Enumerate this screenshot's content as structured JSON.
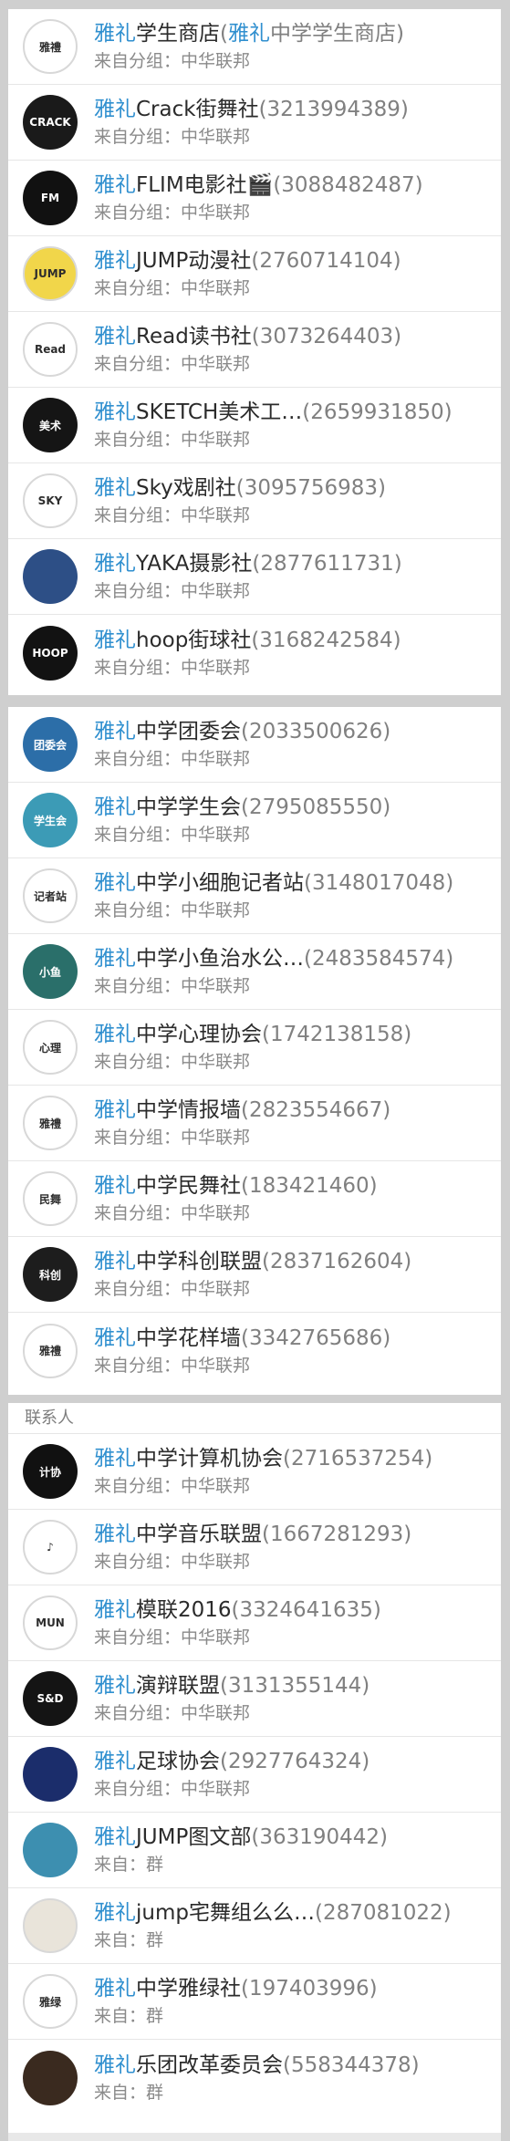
{
  "groups": [
    {
      "items": [
        {
          "prefix": "雅礼",
          "name": "学生商店",
          "tail": "(",
          "tail_prefix": "雅礼",
          "tail_rest": "中学学生商店)",
          "source": "来自分组：中华联邦",
          "avatar_text": "雅禮",
          "avatar_color": "#ffffff"
        },
        {
          "prefix": "雅礼",
          "name": "Crack街舞社",
          "code": "(3213994389)",
          "source": "来自分组：中华联邦",
          "avatar_text": "CRACK",
          "avatar_color": "#1a1a1a"
        },
        {
          "prefix": "雅礼",
          "name": "FLIM电影社🎬",
          "code": "(3088482487)",
          "source": "来自分组：中华联邦",
          "avatar_text": "FM",
          "avatar_color": "#111111"
        },
        {
          "prefix": "雅礼",
          "name": "JUMP动漫社",
          "code": "(2760714104)",
          "source": "来自分组：中华联邦",
          "avatar_text": "JUMP",
          "avatar_color": "#f1d64a"
        },
        {
          "prefix": "雅礼",
          "name": "Read读书社",
          "code": "(3073264403)",
          "source": "来自分组：中华联邦",
          "avatar_text": "Read",
          "avatar_color": "#ffffff"
        },
        {
          "prefix": "雅礼",
          "name": "SKETCH美术工…",
          "code": "(2659931850)",
          "source": "来自分组：中华联邦",
          "avatar_text": "美术",
          "avatar_color": "#151515"
        },
        {
          "prefix": "雅礼",
          "name": "Sky戏剧社",
          "code": "(3095756983)",
          "source": "来自分组：中华联邦",
          "avatar_text": "SKY",
          "avatar_color": "#ffffff"
        },
        {
          "prefix": "雅礼",
          "name": "YAKA摄影社",
          "code": "(2877611731)",
          "source": "来自分组：中华联邦",
          "avatar_text": "",
          "avatar_color": "#2d4f86"
        },
        {
          "prefix": "雅礼",
          "name": "hoop街球社",
          "code": "(3168242584)",
          "source": "来自分组：中华联邦",
          "avatar_text": "HOOP",
          "avatar_color": "#121212"
        }
      ]
    },
    {
      "items": [
        {
          "prefix": "雅礼",
          "name": "中学团委会",
          "code": "(2033500626)",
          "source": "来自分组：中华联邦",
          "avatar_text": "团委会",
          "avatar_color": "#2c6ea8"
        },
        {
          "prefix": "雅礼",
          "name": "中学学生会",
          "code": "(2795085550)",
          "source": "来自分组：中华联邦",
          "avatar_text": "学生会",
          "avatar_color": "#3c9bb6"
        },
        {
          "prefix": "雅礼",
          "name": "中学小细胞记者站",
          "code": "(3148017048)",
          "source": "来自分组：中华联邦",
          "avatar_text": "记者站",
          "avatar_color": "#ffffff"
        },
        {
          "prefix": "雅礼",
          "name": "中学小鱼治水公…",
          "code": "(2483584574)",
          "source": "来自分组：中华联邦",
          "avatar_text": "小鱼",
          "avatar_color": "#2a6f6a"
        },
        {
          "prefix": "雅礼",
          "name": "中学心理协会",
          "code": "(1742138158)",
          "source": "来自分组：中华联邦",
          "avatar_text": "心理",
          "avatar_color": "#ffffff"
        },
        {
          "prefix": "雅礼",
          "name": "中学情报墙",
          "code": "(2823554667)",
          "source": "来自分组：中华联邦",
          "avatar_text": "雅禮",
          "avatar_color": "#ffffff"
        },
        {
          "prefix": "雅礼",
          "name": "中学民舞社",
          "code": "(183421460)",
          "source": "来自分组：中华联邦",
          "avatar_text": "民舞",
          "avatar_color": "#ffffff"
        },
        {
          "prefix": "雅礼",
          "name": "中学科创联盟",
          "code": "(2837162604)",
          "source": "来自分组：中华联邦",
          "avatar_text": "科创",
          "avatar_color": "#1d1d1d"
        },
        {
          "prefix": "雅礼",
          "name": "中学花样墙",
          "code": "(3342765686)",
          "source": "来自分组：中华联邦",
          "avatar_text": "雅禮",
          "avatar_color": "#ffffff"
        }
      ]
    },
    {
      "header": "联系人",
      "items": [
        {
          "prefix": "雅礼",
          "name": "中学计算机协会",
          "code": "(2716537254)",
          "source": "来自分组：中华联邦",
          "avatar_text": "计协",
          "avatar_color": "#111111"
        },
        {
          "prefix": "雅礼",
          "name": "中学音乐联盟",
          "code": "(1667281293)",
          "source": "来自分组：中华联邦",
          "avatar_text": "♪",
          "avatar_color": "#ffffff"
        },
        {
          "prefix": "雅礼",
          "name": "模联2016",
          "code": "(3324641635)",
          "source": "来自分组：中华联邦",
          "avatar_text": "MUN",
          "avatar_color": "#ffffff"
        },
        {
          "prefix": "雅礼",
          "name": "演辩联盟",
          "code": "(3131355144)",
          "source": "来自分组：中华联邦",
          "avatar_text": "S&D",
          "avatar_color": "#141414"
        },
        {
          "prefix": "雅礼",
          "name": "足球协会",
          "code": "(2927764324)",
          "source": "来自分组：中华联邦",
          "avatar_text": "",
          "avatar_color": "#1b2d6b"
        },
        {
          "prefix": "雅礼",
          "name": "JUMP图文部",
          "code": "(363190442)",
          "source": "来自：群",
          "avatar_text": "",
          "avatar_color": "#3d8fb0"
        },
        {
          "prefix": "雅礼",
          "name": "jump宅舞组么么…",
          "code": "(287081022)",
          "source": "来自：群",
          "avatar_text": "",
          "avatar_color": "#e9e4da"
        },
        {
          "prefix": "雅礼",
          "name": "中学雅绿社",
          "code": "(197403996)",
          "source": "来自：群",
          "avatar_text": "雅绿",
          "avatar_color": "#ffffff"
        },
        {
          "prefix": "雅礼",
          "name": "乐团改革委员会",
          "code": "(558344378)",
          "source": "来自：群",
          "avatar_text": "",
          "avatar_color": "#3a2a1f"
        }
      ]
    }
  ]
}
